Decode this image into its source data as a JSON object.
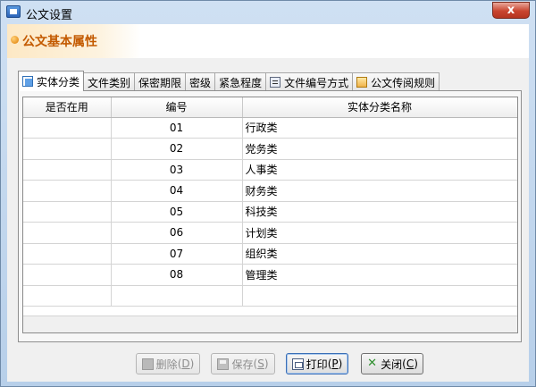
{
  "window": {
    "title": "公文设置",
    "close_symbol": "x"
  },
  "header": {
    "title": "公文基本属性"
  },
  "tabs": [
    {
      "label": "实体分类",
      "icon": "entity-icon",
      "active": true
    },
    {
      "label": "文件类别"
    },
    {
      "label": "保密期限"
    },
    {
      "label": "密级"
    },
    {
      "label": "紧急程度"
    },
    {
      "label": "文件编号方式",
      "icon": "numbering-icon"
    },
    {
      "label": "公文传阅规则",
      "icon": "circulate-icon"
    }
  ],
  "grid": {
    "columns": [
      "是否在用",
      "编号",
      "实体分类名称"
    ],
    "rows": [
      {
        "in_use": "",
        "code": "01",
        "name": "行政类"
      },
      {
        "in_use": "",
        "code": "02",
        "name": "党务类"
      },
      {
        "in_use": "",
        "code": "03",
        "name": "人事类"
      },
      {
        "in_use": "",
        "code": "04",
        "name": "财务类"
      },
      {
        "in_use": "",
        "code": "05",
        "name": "科技类"
      },
      {
        "in_use": "",
        "code": "06",
        "name": "计划类"
      },
      {
        "in_use": "",
        "code": "07",
        "name": "组织类"
      },
      {
        "in_use": "",
        "code": "08",
        "name": "管理类"
      }
    ]
  },
  "buttons": {
    "delete": {
      "label": "删除",
      "shortcut": "D",
      "enabled": false
    },
    "save": {
      "label": "保存",
      "shortcut": "S",
      "enabled": false
    },
    "print": {
      "label": "打印",
      "shortcut": "P",
      "enabled": true
    },
    "close": {
      "label": "关闭",
      "shortcut": "C",
      "enabled": true
    }
  },
  "colors": {
    "header_text": "#c35a00",
    "close_button": "#c9452f",
    "window_frame": "#b7cfe9"
  }
}
